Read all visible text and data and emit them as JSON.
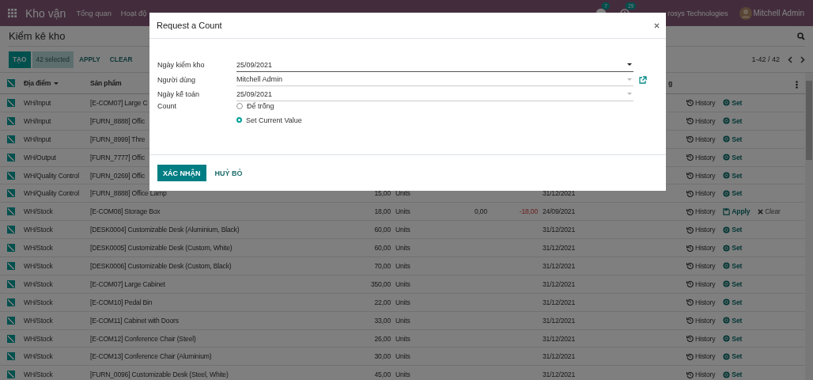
{
  "navbar": {
    "app_name": "Kho vận",
    "menu": [
      "Tổng quan",
      "Hoạt độ"
    ],
    "badges": [
      {
        "kind": "chat",
        "count": "7"
      },
      {
        "kind": "activity",
        "count": "29"
      }
    ],
    "company": "rosys Technologies",
    "user": "Mitchell Admin"
  },
  "control_panel": {
    "title": "Kiểm kê kho",
    "buttons": [
      {
        "kind": "primary",
        "label": "TẠO"
      },
      {
        "kind": "selected",
        "label": "42 selected"
      },
      {
        "kind": "link",
        "label": "APPLY"
      },
      {
        "kind": "link",
        "label": "CLEAR"
      }
    ],
    "pager": "1-42 / 42"
  },
  "table": {
    "all_checked": true,
    "columns": [
      {
        "label": "Địa điểm",
        "sorted": true
      },
      {
        "label": "Sản phẩm",
        "sorted": false
      },
      {
        "label": "g",
        "sorted": false
      }
    ],
    "rows": [
      {
        "checked": true,
        "location": "WH/Input",
        "product": "[E-COM07] Large C",
        "actions": [
          {
            "kind": "history",
            "label": "History"
          },
          {
            "kind": "set",
            "label": "Set"
          }
        ]
      },
      {
        "checked": true,
        "location": "WH/Input",
        "product": "[FURN_8888] Offic",
        "actions": [
          {
            "kind": "history",
            "label": "History"
          },
          {
            "kind": "set",
            "label": "Set"
          }
        ]
      },
      {
        "checked": true,
        "location": "WH/Input",
        "product": "[FURN_8999] Thre",
        "actions": [
          {
            "kind": "history",
            "label": "History"
          },
          {
            "kind": "set",
            "label": "Set"
          }
        ]
      },
      {
        "checked": true,
        "location": "WH/Output",
        "product": "[FURN_7777] Offic",
        "actions": [
          {
            "kind": "history",
            "label": "History"
          },
          {
            "kind": "set",
            "label": "Set"
          }
        ]
      },
      {
        "checked": true,
        "location": "WH/Quality Control",
        "product": "[FURN_0269] Offic",
        "actions": [
          {
            "kind": "history",
            "label": "History"
          },
          {
            "kind": "set",
            "label": "Set"
          }
        ]
      },
      {
        "checked": true,
        "location": "WH/Quality Control",
        "product": "[FURN_8888] Office Lamp",
        "quantity": "15,00",
        "unit": "Units",
        "date": "31/12/2021",
        "actions": [
          {
            "kind": "history",
            "label": "History"
          },
          {
            "kind": "set",
            "label": "Set"
          }
        ]
      },
      {
        "checked": true,
        "location": "WH/Stock",
        "product": "[E-COM08] Storage Box",
        "quantity": "18,00",
        "unit": "Units",
        "counted": "0,00",
        "difference": "-18,00",
        "date": "24/09/2021",
        "actions": [
          {
            "kind": "history",
            "label": "History"
          },
          {
            "kind": "apply",
            "label": "Apply"
          },
          {
            "kind": "clear",
            "label": "Clear"
          }
        ]
      },
      {
        "checked": true,
        "location": "WH/Stock",
        "product": "[DESK0004] Customizable Desk (Aluminium, Black)",
        "quantity": "60,00",
        "unit": "Units",
        "date": "31/12/2021",
        "actions": [
          {
            "kind": "history",
            "label": "History"
          },
          {
            "kind": "set",
            "label": "Set"
          }
        ]
      },
      {
        "checked": true,
        "location": "WH/Stock",
        "product": "[DESK0005] Customizable Desk (Custom, White)",
        "quantity": "60,00",
        "unit": "Units",
        "date": "31/12/2021",
        "actions": [
          {
            "kind": "history",
            "label": "History"
          },
          {
            "kind": "set",
            "label": "Set"
          }
        ]
      },
      {
        "checked": true,
        "location": "WH/Stock",
        "product": "[DESK0006] Customizable Desk (Custom, Black)",
        "quantity": "70,00",
        "unit": "Units",
        "date": "31/12/2021",
        "actions": [
          {
            "kind": "history",
            "label": "History"
          },
          {
            "kind": "set",
            "label": "Set"
          }
        ]
      },
      {
        "checked": true,
        "location": "WH/Stock",
        "product": "[E-COM07] Large Cabinet",
        "quantity": "350,00",
        "unit": "Units",
        "date": "31/12/2021",
        "actions": [
          {
            "kind": "history",
            "label": "History"
          },
          {
            "kind": "set",
            "label": "Set"
          }
        ]
      },
      {
        "checked": true,
        "location": "WH/Stock",
        "product": "[E-COM10] Pedal Bin",
        "quantity": "22,00",
        "unit": "Units",
        "date": "31/12/2021",
        "actions": [
          {
            "kind": "history",
            "label": "History"
          },
          {
            "kind": "set",
            "label": "Set"
          }
        ]
      },
      {
        "checked": true,
        "location": "WH/Stock",
        "product": "[E-COM11] Cabinet with Doors",
        "quantity": "33,00",
        "unit": "Units",
        "date": "31/12/2021",
        "actions": [
          {
            "kind": "history",
            "label": "History"
          },
          {
            "kind": "set",
            "label": "Set"
          }
        ]
      },
      {
        "checked": true,
        "location": "WH/Stock",
        "product": "[E-COM12] Conference Chair (Steel)",
        "quantity": "26,00",
        "unit": "Units",
        "date": "31/12/2021",
        "actions": [
          {
            "kind": "history",
            "label": "History"
          },
          {
            "kind": "set",
            "label": "Set"
          }
        ]
      },
      {
        "checked": true,
        "location": "WH/Stock",
        "product": "[E-COM13] Conference Chair (Aluminium)",
        "quantity": "30,00",
        "unit": "Units",
        "date": "31/12/2021",
        "actions": [
          {
            "kind": "history",
            "label": "History"
          },
          {
            "kind": "set",
            "label": "Set"
          }
        ]
      },
      {
        "checked": true,
        "location": "WH/Stock",
        "product": "[FURN_0096] Customizable Desk (Steel, White)",
        "quantity": "45,00",
        "unit": "Units",
        "date": "31/12/2021",
        "actions": [
          {
            "kind": "history",
            "label": "History"
          },
          {
            "kind": "set",
            "label": "Set"
          }
        ]
      }
    ]
  },
  "dialog": {
    "title": "Request a Count",
    "fields": [
      {
        "kind": "date",
        "label": "Ngày kiểm kho",
        "value": "25/09/2021"
      },
      {
        "kind": "many2one",
        "label": "Người dùng",
        "value": "Mitchell Admin"
      },
      {
        "kind": "select",
        "label": "Ngày kế toán",
        "value": "25/09/2021"
      }
    ],
    "count": {
      "label": "Count",
      "options": [
        {
          "label": "Để trống",
          "selected": false
        },
        {
          "label": "Set Current Value",
          "selected": true
        }
      ]
    },
    "buttons": [
      {
        "kind": "primary",
        "label": "XÁC NHẬN"
      },
      {
        "kind": "link",
        "label": "HUỶ BỎ"
      }
    ]
  }
}
